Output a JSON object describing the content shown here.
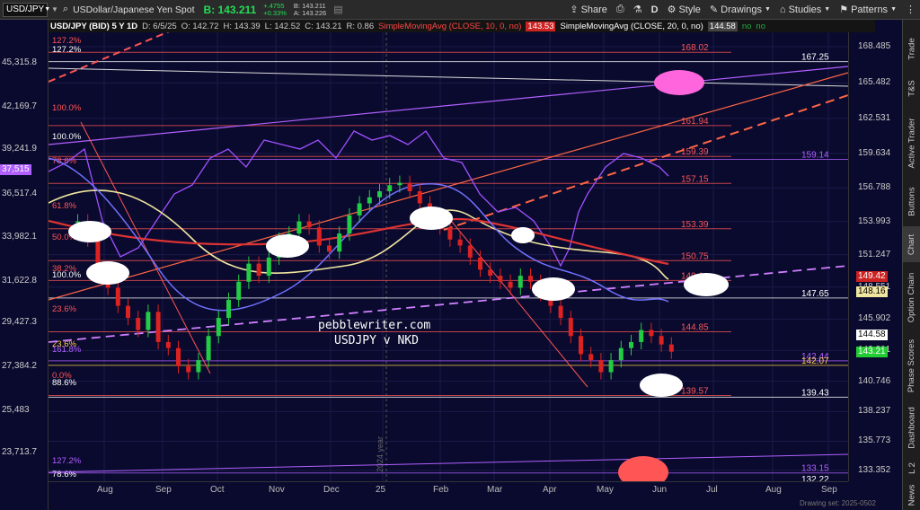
{
  "toolbar": {
    "symbol": "USD/JPY",
    "description": "USDollar/Japanese Yen Spot",
    "bid_label": "B: 143.211",
    "change": "+.4755",
    "change_pct": "+0.33%",
    "bid_small": "B: 143.211",
    "ask_small": "A: 143.226",
    "share": "Share",
    "period": "D",
    "style": "Style",
    "drawings": "Drawings",
    "studies": "Studies",
    "patterns": "Patterns"
  },
  "infobar": {
    "title": "USD/JPY (BID) 5 Y 1D",
    "date": "D: 6/5/25",
    "open": "O: 142.72",
    "high": "H: 143.39",
    "low": "L: 142.52",
    "close": "C: 143.21",
    "range": "R: 0.86",
    "sma10": "SimpleMovingAvg (CLOSE, 10, 0, no)",
    "sma10_val": "143.53",
    "sma20": "SimpleMovingAvg (CLOSE, 20, 0, no)",
    "sma20_val": "144.58",
    "no1": "no",
    "no2": "no"
  },
  "watermark": {
    "line1": "pebblewriter.com",
    "line2": "USDJPY v NKD"
  },
  "year_label": "2024 year",
  "left_axis": [
    "45,315.8",
    "42,169.7",
    "39,241.9",
    "36,517.4",
    "33,982.1",
    "31,622.8",
    "29,427.3",
    "27,384.2",
    "25,483",
    "23,713.7"
  ],
  "right_axis": [
    "168.485",
    "165.482",
    "162.531",
    "159.634",
    "156.788",
    "153.993",
    "151.247",
    "148.551",
    "145.902",
    "143.301",
    "140.746",
    "138.237",
    "135.773",
    "133.352"
  ],
  "x_axis": [
    "Aug",
    "Sep",
    "Oct",
    "Nov",
    "Dec",
    "25",
    "Feb",
    "Mar",
    "Apr",
    "May",
    "Jun",
    "Jul",
    "Aug",
    "Sep"
  ],
  "nkd_tag": "37,515",
  "right_tags": {
    "sma_a": "149.42",
    "sma_b": "148.16",
    "sma_c": "144.58",
    "last": "143.21"
  },
  "fib_left": [
    "127.2%",
    "127.2%",
    "100.0%",
    "100.0%",
    "78.6%",
    "61.8%",
    "50.0%",
    "38.2%",
    "100.0%",
    "23.6%",
    "23.6%",
    "161.8%",
    "0.0%",
    "88.6%",
    "127.2%",
    "78.6%"
  ],
  "fib_right": [
    "168.02",
    "167.25",
    "161.94",
    "159.39",
    "159.14",
    "157.15",
    "153.39",
    "150.75",
    "149.1",
    "147.65",
    "144.85",
    "142.44",
    "142.07",
    "139.57",
    "139.43",
    "133.15",
    "132.22"
  ],
  "drawing_set": "Drawing set: 2025-0502",
  "sidetabs": [
    "Trade",
    "T&S",
    "Active Trader",
    "Buttons",
    "Chart",
    "Option Chain",
    "Phase Scores",
    "Dashboard",
    "L 2",
    "News"
  ],
  "colors": {
    "background": "#0a0a2e",
    "fib": "#ff6666",
    "nkd": "#b060ff",
    "up": "#22cc44",
    "down": "#dd2222"
  },
  "chart_data": {
    "type": "candlestick",
    "x": [
      "Aug",
      "Sep",
      "Oct",
      "Nov",
      "Dec",
      "25",
      "Feb",
      "Mar",
      "Apr",
      "May",
      "Jun",
      "Jul",
      "Aug",
      "Sep"
    ],
    "ylim": [
      133.0,
      170.0
    ],
    "closes": [
      154.0,
      152.5,
      150.0,
      148.5,
      147.0,
      146.0,
      145.0,
      146.5,
      144.0,
      143.5,
      142.0,
      141.5,
      142.5,
      144.5,
      146.0,
      147.5,
      149.0,
      150.5,
      149.5,
      151.0,
      152.5,
      153.0,
      154.0,
      153.5,
      152.0,
      151.5,
      153.0,
      154.5,
      155.5,
      156.0,
      156.5,
      157.0,
      157.2,
      156.5,
      155.5,
      154.5,
      153.5,
      152.5,
      152.0,
      151.0,
      150.0,
      149.5,
      149.0,
      148.5,
      149.5,
      149.0,
      148.0,
      147.0,
      146.0,
      144.5,
      143.0,
      142.5,
      141.5,
      142.5,
      143.5,
      144.0,
      145.0,
      144.5,
      143.8,
      143.2
    ]
  }
}
